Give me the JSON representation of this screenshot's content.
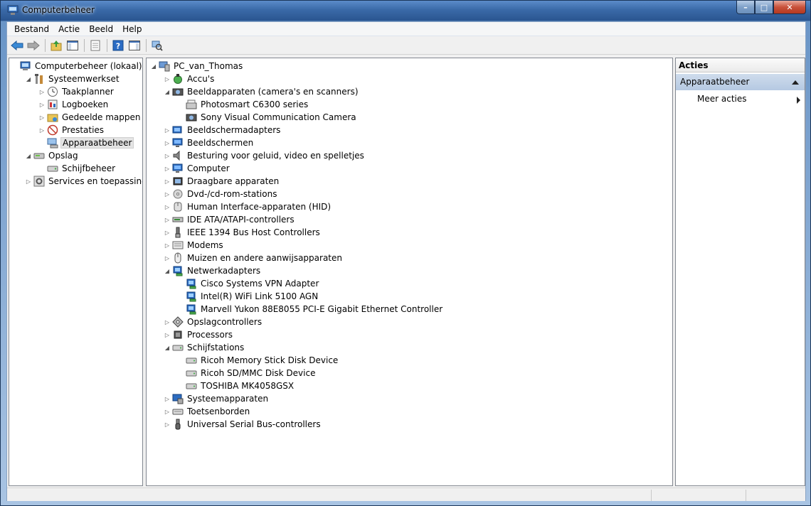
{
  "window": {
    "title": "Computerbeheer",
    "controls": {
      "minimize": "–",
      "maximize": "□",
      "close": "✕"
    }
  },
  "menubar": [
    "Bestand",
    "Actie",
    "Beeld",
    "Help"
  ],
  "toolbar": [
    "back-arrow-icon",
    "forward-arrow-icon",
    "up-folder-icon",
    "show-hide-tree-icon",
    "export-list-icon",
    "help-icon",
    "show-hide-action-pane-icon",
    "scan-hardware-icon"
  ],
  "left_tree": [
    {
      "label": "Computerbeheer (lokaal)",
      "level": 0,
      "expander": "",
      "icon": "computer-management-icon"
    },
    {
      "label": "Systeemwerkset",
      "level": 1,
      "expander": "◢",
      "icon": "tools-icon"
    },
    {
      "label": "Taakplanner",
      "level": 2,
      "expander": "▷",
      "icon": "clock-icon"
    },
    {
      "label": "Logboeken",
      "level": 2,
      "expander": "▷",
      "icon": "event-viewer-icon"
    },
    {
      "label": "Gedeelde mappen",
      "level": 2,
      "expander": "▷",
      "icon": "shared-folder-icon"
    },
    {
      "label": "Prestaties",
      "level": 2,
      "expander": "▷",
      "icon": "performance-icon"
    },
    {
      "label": "Apparaatbeheer",
      "level": 2,
      "expander": "",
      "icon": "device-manager-icon",
      "selected": true
    },
    {
      "label": "Opslag",
      "level": 1,
      "expander": "◢",
      "icon": "storage-icon"
    },
    {
      "label": "Schijfbeheer",
      "level": 2,
      "expander": "",
      "icon": "disk-management-icon"
    },
    {
      "label": "Services en toepassingen",
      "level": 1,
      "expander": "▷",
      "icon": "services-icon"
    }
  ],
  "device_tree": [
    {
      "label": "PC_van_Thomas",
      "level": 0,
      "expander": "◢",
      "icon": "computer-icon"
    },
    {
      "label": "Accu's",
      "level": 1,
      "expander": "▷",
      "icon": "battery-icon"
    },
    {
      "label": "Beeldapparaten (camera's en scanners)",
      "level": 1,
      "expander": "◢",
      "icon": "camera-icon"
    },
    {
      "label": "Photosmart C6300 series",
      "level": 2,
      "expander": "",
      "icon": "scanner-icon"
    },
    {
      "label": "Sony Visual Communication Camera",
      "level": 2,
      "expander": "",
      "icon": "camera-icon"
    },
    {
      "label": "Beeldschermadapters",
      "level": 1,
      "expander": "▷",
      "icon": "display-adapter-icon"
    },
    {
      "label": "Beeldschermen",
      "level": 1,
      "expander": "▷",
      "icon": "monitor-icon"
    },
    {
      "label": "Besturing voor geluid, video en spelletjes",
      "level": 1,
      "expander": "▷",
      "icon": "speaker-icon"
    },
    {
      "label": "Computer",
      "level": 1,
      "expander": "▷",
      "icon": "monitor-icon"
    },
    {
      "label": "Draagbare apparaten",
      "level": 1,
      "expander": "▷",
      "icon": "portable-device-icon"
    },
    {
      "label": "Dvd-/cd-rom-stations",
      "level": 1,
      "expander": "▷",
      "icon": "dvd-icon"
    },
    {
      "label": "Human Interface-apparaten (HID)",
      "level": 1,
      "expander": "▷",
      "icon": "hid-icon"
    },
    {
      "label": "IDE ATA/ATAPI-controllers",
      "level": 1,
      "expander": "▷",
      "icon": "ide-icon"
    },
    {
      "label": "IEEE 1394 Bus Host Controllers",
      "level": 1,
      "expander": "▷",
      "icon": "firewire-icon"
    },
    {
      "label": "Modems",
      "level": 1,
      "expander": "▷",
      "icon": "modem-icon"
    },
    {
      "label": "Muizen en andere aanwijsapparaten",
      "level": 1,
      "expander": "▷",
      "icon": "mouse-icon"
    },
    {
      "label": "Netwerkadapters",
      "level": 1,
      "expander": "◢",
      "icon": "network-adapter-icon"
    },
    {
      "label": "Cisco Systems VPN Adapter",
      "level": 2,
      "expander": "",
      "icon": "network-adapter-icon"
    },
    {
      "label": "Intel(R) WiFi Link 5100 AGN",
      "level": 2,
      "expander": "",
      "icon": "network-adapter-icon"
    },
    {
      "label": "Marvell Yukon 88E8055 PCI-E Gigabit Ethernet Controller",
      "level": 2,
      "expander": "",
      "icon": "network-adapter-icon"
    },
    {
      "label": "Opslagcontrollers",
      "level": 1,
      "expander": "▷",
      "icon": "storage-controller-icon"
    },
    {
      "label": "Processors",
      "level": 1,
      "expander": "▷",
      "icon": "processor-icon"
    },
    {
      "label": "Schijfstations",
      "level": 1,
      "expander": "◢",
      "icon": "disk-drive-icon"
    },
    {
      "label": "Ricoh Memory Stick Disk Device",
      "level": 2,
      "expander": "",
      "icon": "disk-drive-icon"
    },
    {
      "label": "Ricoh SD/MMC Disk Device",
      "level": 2,
      "expander": "",
      "icon": "disk-drive-icon"
    },
    {
      "label": "TOSHIBA MK4058GSX",
      "level": 2,
      "expander": "",
      "icon": "disk-drive-icon"
    },
    {
      "label": "Systeemapparaten",
      "level": 1,
      "expander": "▷",
      "icon": "system-device-icon"
    },
    {
      "label": "Toetsenborden",
      "level": 1,
      "expander": "▷",
      "icon": "keyboard-icon"
    },
    {
      "label": "Universal Serial Bus-controllers",
      "level": 1,
      "expander": "▷",
      "icon": "usb-icon"
    }
  ],
  "actions": {
    "header": "Acties",
    "section": "Apparaatbeheer",
    "more": "Meer acties"
  },
  "colors": {
    "title_bar": "#3a6aa8",
    "selection": "#e4e4e4",
    "actions_section": "#c3d4ea"
  }
}
